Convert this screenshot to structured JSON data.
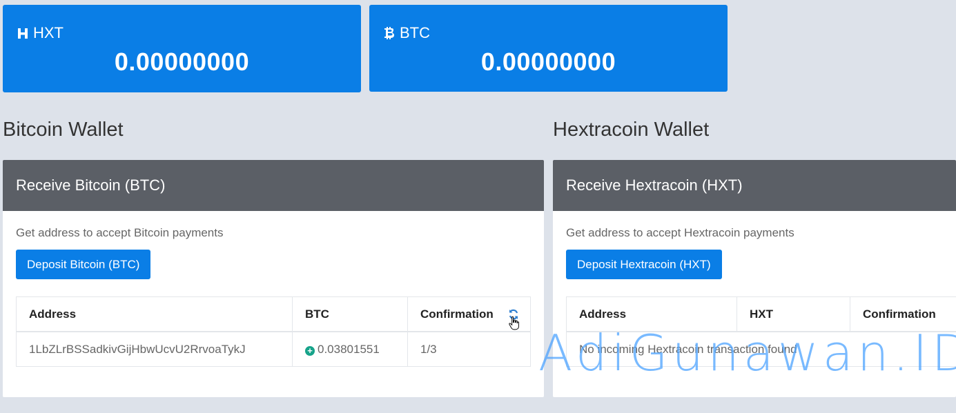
{
  "balances": [
    {
      "currency": "HXT",
      "amount": "0.00000000",
      "icon": "hextracoin-icon"
    },
    {
      "currency": "BTC",
      "amount": "0.00000000",
      "icon": "bitcoin-icon"
    }
  ],
  "bitcoin_wallet": {
    "title": "Bitcoin Wallet",
    "header": "Receive Bitcoin (BTC)",
    "description": "Get address to accept Bitcoin payments",
    "deposit_label": "Deposit Bitcoin (BTC)",
    "columns": [
      "Address",
      "BTC",
      "Confirmation"
    ],
    "rows": [
      {
        "address": "1LbZLrBSSadkivGijHbwUcvU2RrvoaTykJ",
        "amount": "0.03801551",
        "confirmation": "1/3"
      }
    ]
  },
  "hextracoin_wallet": {
    "title": "Hextracoin Wallet",
    "header": "Receive Hextracoin (HXT)",
    "description": "Get address to accept Hextracoin payments",
    "deposit_label": "Deposit Hextracoin (HXT)",
    "columns": [
      "Address",
      "HXT",
      "Confirmation"
    ],
    "empty_message": "No incoming Hextracoin transaction found"
  },
  "watermark": "AdiGunawan.ID",
  "colors": {
    "accent": "#0a7ee6",
    "panel_header": "#5b5f66",
    "background": "#dde2ea",
    "positive": "#17a38a"
  }
}
